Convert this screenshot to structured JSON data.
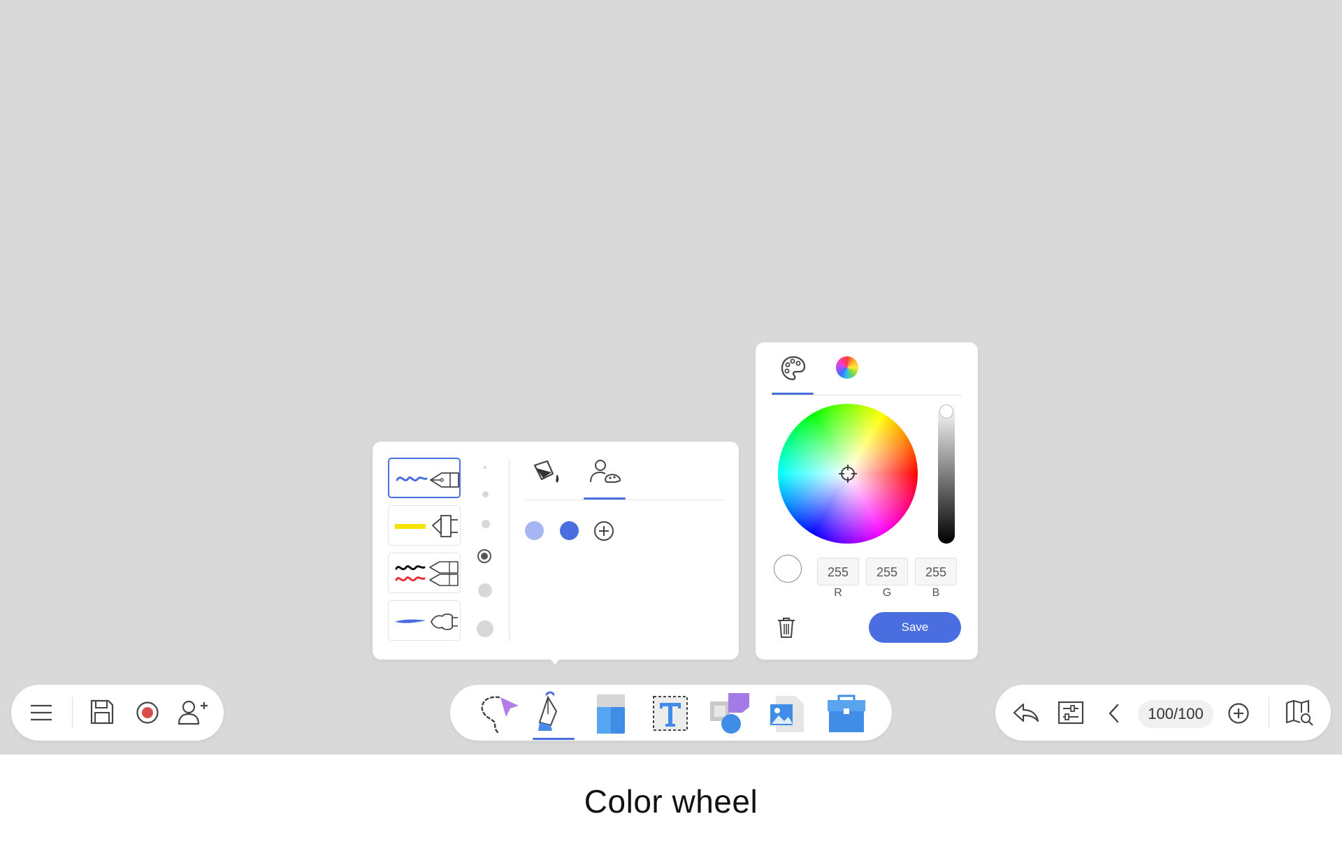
{
  "app": {
    "caption": "Color wheel"
  },
  "left_toolbar": {
    "items": [
      {
        "name": "menu",
        "icon": "hamburger-menu-icon"
      },
      {
        "name": "save",
        "icon": "floppy-disk-icon"
      },
      {
        "name": "record",
        "icon": "record-icon"
      },
      {
        "name": "invite",
        "icon": "add-user-icon"
      }
    ],
    "record_color": "#d94c4c"
  },
  "center_toolbar": {
    "tools": [
      {
        "name": "select",
        "icon": "lasso-select-icon"
      },
      {
        "name": "pen",
        "icon": "pen-icon",
        "active": true
      },
      {
        "name": "eraser",
        "icon": "eraser-icon"
      },
      {
        "name": "text",
        "icon": "text-icon"
      },
      {
        "name": "shapes",
        "icon": "shapes-icon"
      },
      {
        "name": "image",
        "icon": "image-icon"
      },
      {
        "name": "toolbox",
        "icon": "toolbox-icon"
      }
    ]
  },
  "right_toolbar": {
    "page_counter": "100/100",
    "items": [
      {
        "name": "undo",
        "icon": "undo-arrow-icon"
      },
      {
        "name": "settings",
        "icon": "sliders-icon"
      },
      {
        "name": "previous-page",
        "icon": "chevron-left-icon"
      },
      {
        "name": "add-page",
        "icon": "plus-circle-icon"
      },
      {
        "name": "map",
        "icon": "map-zoom-icon"
      }
    ]
  },
  "pen_panel": {
    "pen_types": [
      {
        "name": "ballpoint",
        "icon": "ballpoint-pen-icon",
        "stroke_color": "#4a6ee0",
        "active": true
      },
      {
        "name": "highlighter",
        "icon": "highlighter-icon",
        "stroke_color": "#f2e400"
      },
      {
        "name": "dual-color",
        "icon": "dual-pen-icon",
        "stroke_colors": [
          "#111111",
          "#e8303a"
        ]
      },
      {
        "name": "brush",
        "icon": "brush-pen-icon",
        "stroke_color": "#4a6ee0"
      }
    ],
    "sizes": [
      "xs",
      "s",
      "m",
      "l",
      "xl",
      "xxl"
    ],
    "selected_size": "l",
    "tabs": [
      {
        "name": "fill",
        "icon": "paint-bucket-icon"
      },
      {
        "name": "custom-colors",
        "icon": "user-palette-icon",
        "active": true
      }
    ],
    "swatches": [
      "#a6b6f2",
      "#4a6ee0"
    ],
    "add_swatch_icon": "plus-circle-icon"
  },
  "color_picker": {
    "tabs": [
      {
        "name": "palette",
        "icon": "palette-icon",
        "active": true
      },
      {
        "name": "wheel",
        "icon": "color-wheel-icon"
      }
    ],
    "r": "255",
    "g": "255",
    "b": "255",
    "r_label": "R",
    "g_label": "G",
    "b_label": "B",
    "save_label": "Save",
    "preview_color": "#ffffff",
    "accent": "#4a6ee0"
  }
}
